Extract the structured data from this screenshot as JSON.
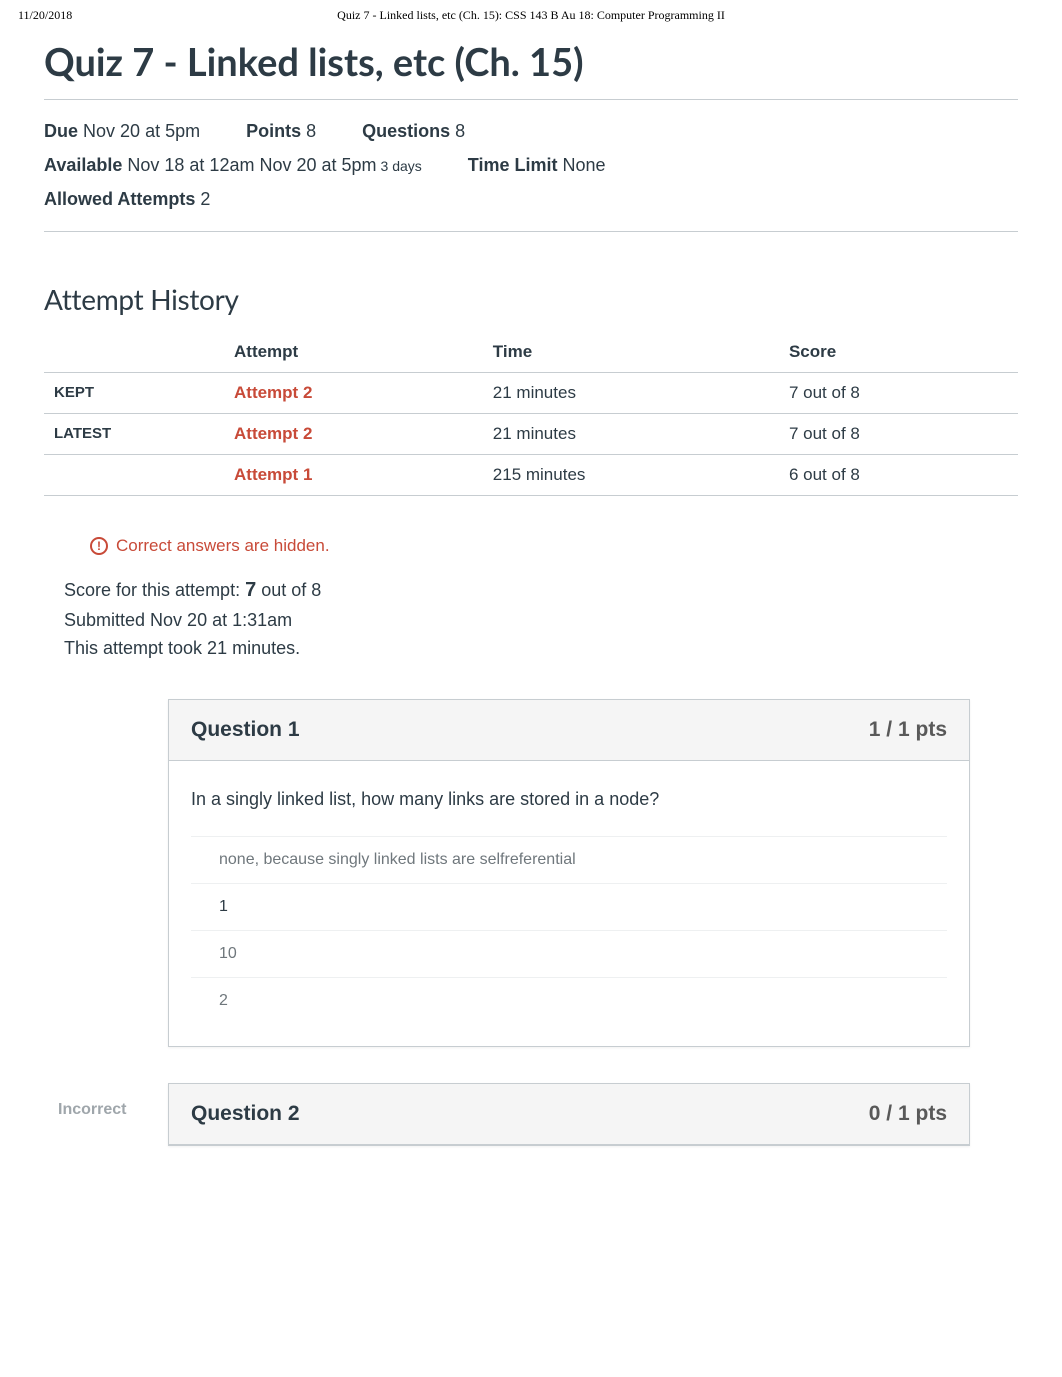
{
  "print": {
    "date": "11/20/2018",
    "title": "Quiz 7 - Linked lists, etc (Ch. 15): CSS 143 B Au 18: Computer Programming II"
  },
  "page_title": "Quiz 7 - Linked lists, etc (Ch. 15)",
  "meta": {
    "due_label": "Due",
    "due_value": "Nov 20 at 5pm",
    "points_label": "Points",
    "points_value": "8",
    "questions_label": "Questions",
    "questions_value": "8",
    "available_label": "Available",
    "available_value": "Nov 18 at 12am  Nov 20 at 5pm",
    "available_sub": "3 days",
    "timelimit_label": "Time Limit",
    "timelimit_value": "None",
    "attempts_label": "Allowed Attempts",
    "attempts_value": "2"
  },
  "history": {
    "heading": "Attempt History",
    "cols": {
      "attempt": "Attempt",
      "time": "Time",
      "score": "Score"
    },
    "rows": [
      {
        "tag": "KEPT",
        "attempt": "Attempt 2",
        "time": "21 minutes",
        "score": "7 out of 8"
      },
      {
        "tag": "LATEST",
        "attempt": "Attempt 2",
        "time": "21 minutes",
        "score": "7 out of 8"
      },
      {
        "tag": "",
        "attempt": "Attempt 1",
        "time": "215 minutes",
        "score": "6 out of 8"
      }
    ]
  },
  "hidden_msg": "Correct answers are hidden.",
  "score_line": {
    "prefix": "Score for this attempt: ",
    "score": "7",
    "suffix": " out of 8",
    "submitted": "Submitted Nov 20 at 1:31am",
    "took": "This attempt took 21 minutes."
  },
  "questions": [
    {
      "side": "",
      "title": "Question 1",
      "pts": "1 / 1 pts",
      "prompt": "In a singly linked list, how many links are stored in a node?",
      "answers": [
        {
          "text": "none, because singly linked lists are selfreferential",
          "selected": false
        },
        {
          "text": "1",
          "selected": true
        },
        {
          "text": "10",
          "selected": false
        },
        {
          "text": "2",
          "selected": false
        }
      ]
    },
    {
      "side": "Incorrect",
      "title": "Question 2",
      "pts": "0 / 1 pts",
      "prompt": "",
      "answers": []
    }
  ]
}
